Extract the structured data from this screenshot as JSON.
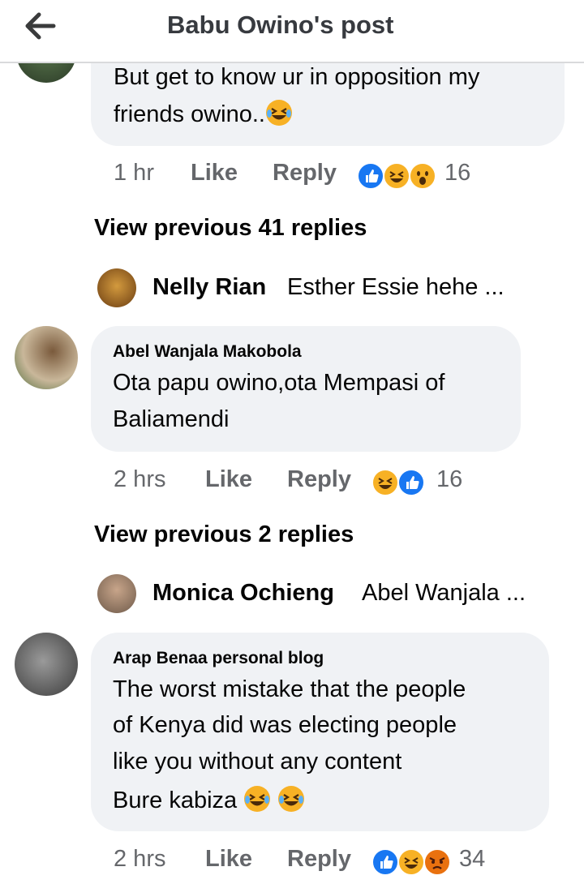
{
  "header": {
    "title": "Babu Owino's post",
    "back_icon": "back-arrow-icon"
  },
  "comments": [
    {
      "author": "",
      "lines": [
        "But get to know ur in opposition my",
        "friends owino.."
      ],
      "time": "1 hr",
      "like_label": "Like",
      "reply_label": "Reply",
      "reactions": [
        "like",
        "haha",
        "wow"
      ],
      "reaction_count": "16",
      "view_previous": "View previous 41 replies",
      "latest_reply": {
        "name": "Nelly Rian",
        "snippet": "Esther Essie hehe ..."
      }
    },
    {
      "author": "Abel Wanjala Makobola",
      "lines": [
        "Ota papu owino,ota Mempasi of",
        "Baliamendi"
      ],
      "time": "2 hrs",
      "like_label": "Like",
      "reply_label": "Reply",
      "reactions": [
        "haha",
        "like"
      ],
      "reaction_count": "16",
      "view_previous": "View previous 2 replies",
      "latest_reply": {
        "name": "Monica Ochieng",
        "snippet": "Abel Wanjala ..."
      }
    },
    {
      "author": "Arap Benaa personal blog",
      "lines": [
        "The worst mistake that the people",
        "of Kenya did was electing people",
        "like you without any content",
        "Bure kabiza"
      ],
      "time": "2 hrs",
      "like_label": "Like",
      "reply_label": "Reply",
      "reactions": [
        "like",
        "haha",
        "angry"
      ],
      "reaction_count": "34"
    }
  ],
  "colors": {
    "like": "#1877f2",
    "haha": "#f7b125",
    "angry": "#e9710f",
    "bubble": "#f0f2f5",
    "meta": "#65676b"
  }
}
